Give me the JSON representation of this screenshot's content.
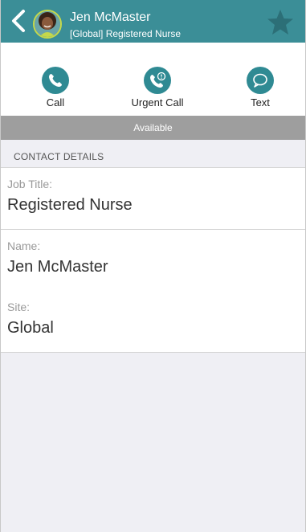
{
  "header": {
    "name": "Jen McMaster",
    "subtitle": "[Global] Registered Nurse",
    "favorite": false
  },
  "actions": [
    {
      "label": "Call",
      "icon": "phone-icon"
    },
    {
      "label": "Urgent Call",
      "icon": "urgent-phone-icon"
    },
    {
      "label": "Text",
      "icon": "chat-bubble-icon"
    }
  ],
  "status": "Available",
  "contact_details": {
    "heading": "CONTACT DETAILS",
    "fields": [
      {
        "label": "Job Title:",
        "value": "Registered Nurse"
      },
      {
        "label": "Name:",
        "value": "Jen McMaster"
      },
      {
        "label": "Site:",
        "value": "Global"
      }
    ]
  },
  "colors": {
    "header_bg": "#3b8e97",
    "action_icon_bg": "#2f8a93",
    "status_bg": "#9e9e9e",
    "star": "#2c6f77",
    "avatar_ring": "#c6d94a"
  }
}
